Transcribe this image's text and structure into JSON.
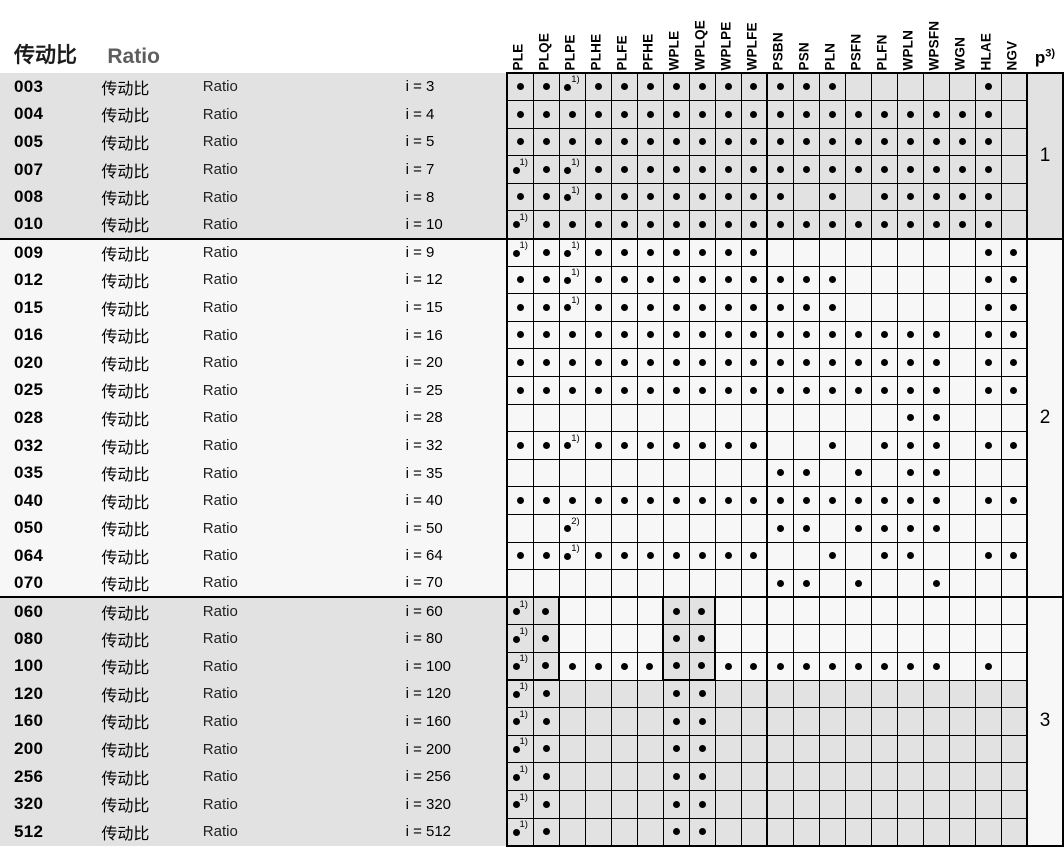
{
  "header": {
    "title_cn": "传动比",
    "title_en": "Ratio",
    "p_label": "p",
    "p_sup": "3)",
    "columns": [
      {
        "key": "PLE",
        "label": "PLE"
      },
      {
        "key": "PLQE",
        "label": "PLQE"
      },
      {
        "key": "PLPE",
        "label": "PLPE"
      },
      {
        "key": "PLHE",
        "label": "PLHE"
      },
      {
        "key": "PLFE",
        "label": "PLFE"
      },
      {
        "key": "PFHE",
        "label": "PFHE"
      },
      {
        "key": "WPLE",
        "label": "WPLE"
      },
      {
        "key": "WPLQE",
        "label": "WPLQE"
      },
      {
        "key": "WPLPE",
        "label": "WPLPE"
      },
      {
        "key": "WPLFE",
        "label": "WPLFE"
      },
      {
        "key": "PSBN",
        "label": "PSBN"
      },
      {
        "key": "PSN",
        "label": "PSN"
      },
      {
        "key": "PLN",
        "label": "PLN"
      },
      {
        "key": "PSFN",
        "label": "PSFN"
      },
      {
        "key": "PLFN",
        "label": "PLFN"
      },
      {
        "key": "WPLN",
        "label": "WPLN"
      },
      {
        "key": "WPSFN",
        "label": "WPSFN"
      },
      {
        "key": "WGN",
        "label": "WGN"
      },
      {
        "key": "HLAE",
        "label": "HLAE"
      },
      {
        "key": "NGV",
        "label": "NGV"
      }
    ]
  },
  "row_labels": {
    "ratio_cn": "传动比",
    "ratio_en": "Ratio"
  },
  "groups": [
    {
      "p": "1",
      "style": "shaded",
      "rows": [
        {
          "code": "003",
          "value": "i = 3",
          "marks": {
            "PLE": "dot",
            "PLQE": "dot",
            "PLPE": "dot1",
            "PLHE": "dot",
            "PLFE": "dot",
            "PFHE": "dot",
            "WPLE": "dot",
            "WPLQE": "dot",
            "WPLPE": "dot",
            "WPLFE": "dot",
            "PSBN": "dot",
            "PSN": "dot",
            "PLN": "dot",
            "HLAE": "dot"
          }
        },
        {
          "code": "004",
          "value": "i = 4",
          "marks": {
            "PLE": "dot",
            "PLQE": "dot",
            "PLPE": "dot",
            "PLHE": "dot",
            "PLFE": "dot",
            "PFHE": "dot",
            "WPLE": "dot",
            "WPLQE": "dot",
            "WPLPE": "dot",
            "WPLFE": "dot",
            "PSBN": "dot",
            "PSN": "dot",
            "PLN": "dot",
            "PSFN": "dot",
            "PLFN": "dot",
            "WPLN": "dot",
            "WPSFN": "dot",
            "WGN": "dot",
            "HLAE": "dot"
          }
        },
        {
          "code": "005",
          "value": "i = 5",
          "marks": {
            "PLE": "dot",
            "PLQE": "dot",
            "PLPE": "dot",
            "PLHE": "dot",
            "PLFE": "dot",
            "PFHE": "dot",
            "WPLE": "dot",
            "WPLQE": "dot",
            "WPLPE": "dot",
            "WPLFE": "dot",
            "PSBN": "dot",
            "PSN": "dot",
            "PLN": "dot",
            "PSFN": "dot",
            "PLFN": "dot",
            "WPLN": "dot",
            "WPSFN": "dot",
            "WGN": "dot",
            "HLAE": "dot"
          }
        },
        {
          "code": "007",
          "value": "i = 7",
          "marks": {
            "PLE": "dot1",
            "PLQE": "dot",
            "PLPE": "dot1",
            "PLHE": "dot",
            "PLFE": "dot",
            "PFHE": "dot",
            "WPLE": "dot",
            "WPLQE": "dot",
            "WPLPE": "dot",
            "WPLFE": "dot",
            "PSBN": "dot",
            "PSN": "dot",
            "PLN": "dot",
            "PSFN": "dot",
            "PLFN": "dot",
            "WPLN": "dot",
            "WPSFN": "dot",
            "WGN": "dot",
            "HLAE": "dot"
          }
        },
        {
          "code": "008",
          "value": "i = 8",
          "marks": {
            "PLE": "dot",
            "PLQE": "dot",
            "PLPE": "dot1",
            "PLHE": "dot",
            "PLFE": "dot",
            "PFHE": "dot",
            "WPLE": "dot",
            "WPLQE": "dot",
            "WPLPE": "dot",
            "WPLFE": "dot",
            "PSBN": "dot",
            "PLN": "dot",
            "PLFN": "dot",
            "WPLN": "dot",
            "WPSFN": "dot",
            "WGN": "dot",
            "HLAE": "dot"
          }
        },
        {
          "code": "010",
          "value": "i = 10",
          "marks": {
            "PLE": "dot1",
            "PLQE": "dot",
            "PLPE": "dot",
            "PLHE": "dot",
            "PLFE": "dot",
            "PFHE": "dot",
            "WPLE": "dot",
            "WPLQE": "dot",
            "WPLPE": "dot",
            "WPLFE": "dot",
            "PSBN": "dot",
            "PSN": "dot",
            "PLN": "dot",
            "PSFN": "dot",
            "PLFN": "dot",
            "WPLN": "dot",
            "WPSFN": "dot",
            "WGN": "dot",
            "HLAE": "dot"
          }
        }
      ]
    },
    {
      "p": "2",
      "style": "plain",
      "rows": [
        {
          "code": "009",
          "value": "i = 9",
          "marks": {
            "PLE": "dot1",
            "PLQE": "dot",
            "PLPE": "dot1",
            "PLHE": "dot",
            "PLFE": "dot",
            "PFHE": "dot",
            "WPLE": "dot",
            "WPLQE": "dot",
            "WPLPE": "dot",
            "WPLFE": "dot",
            "HLAE": "dot",
            "NGV": "dot"
          }
        },
        {
          "code": "012",
          "value": "i = 12",
          "marks": {
            "PLE": "dot",
            "PLQE": "dot",
            "PLPE": "dot1",
            "PLHE": "dot",
            "PLFE": "dot",
            "PFHE": "dot",
            "WPLE": "dot",
            "WPLQE": "dot",
            "WPLPE": "dot",
            "WPLFE": "dot",
            "PSBN": "dot",
            "PSN": "dot",
            "PLN": "dot",
            "HLAE": "dot",
            "NGV": "dot"
          }
        },
        {
          "code": "015",
          "value": "i = 15",
          "marks": {
            "PLE": "dot",
            "PLQE": "dot",
            "PLPE": "dot1",
            "PLHE": "dot",
            "PLFE": "dot",
            "PFHE": "dot",
            "WPLE": "dot",
            "WPLQE": "dot",
            "WPLPE": "dot",
            "WPLFE": "dot",
            "PSBN": "dot",
            "PSN": "dot",
            "PLN": "dot",
            "HLAE": "dot",
            "NGV": "dot"
          }
        },
        {
          "code": "016",
          "value": "i = 16",
          "marks": {
            "PLE": "dot",
            "PLQE": "dot",
            "PLPE": "dot",
            "PLHE": "dot",
            "PLFE": "dot",
            "PFHE": "dot",
            "WPLE": "dot",
            "WPLQE": "dot",
            "WPLPE": "dot",
            "WPLFE": "dot",
            "PSBN": "dot",
            "PSN": "dot",
            "PLN": "dot",
            "PSFN": "dot",
            "PLFN": "dot",
            "WPLN": "dot",
            "WPSFN": "dot",
            "HLAE": "dot",
            "NGV": "dot"
          }
        },
        {
          "code": "020",
          "value": "i = 20",
          "marks": {
            "PLE": "dot",
            "PLQE": "dot",
            "PLPE": "dot",
            "PLHE": "dot",
            "PLFE": "dot",
            "PFHE": "dot",
            "WPLE": "dot",
            "WPLQE": "dot",
            "WPLPE": "dot",
            "WPLFE": "dot",
            "PSBN": "dot",
            "PSN": "dot",
            "PLN": "dot",
            "PSFN": "dot",
            "PLFN": "dot",
            "WPLN": "dot",
            "WPSFN": "dot",
            "HLAE": "dot",
            "NGV": "dot"
          }
        },
        {
          "code": "025",
          "value": "i = 25",
          "marks": {
            "PLE": "dot",
            "PLQE": "dot",
            "PLPE": "dot",
            "PLHE": "dot",
            "PLFE": "dot",
            "PFHE": "dot",
            "WPLE": "dot",
            "WPLQE": "dot",
            "WPLPE": "dot",
            "WPLFE": "dot",
            "PSBN": "dot",
            "PSN": "dot",
            "PLN": "dot",
            "PSFN": "dot",
            "PLFN": "dot",
            "WPLN": "dot",
            "WPSFN": "dot",
            "HLAE": "dot",
            "NGV": "dot"
          }
        },
        {
          "code": "028",
          "value": "i = 28",
          "marks": {
            "WPLN": "dot",
            "WPSFN": "dot"
          }
        },
        {
          "code": "032",
          "value": "i = 32",
          "marks": {
            "PLE": "dot",
            "PLQE": "dot",
            "PLPE": "dot1",
            "PLHE": "dot",
            "PLFE": "dot",
            "PFHE": "dot",
            "WPLE": "dot",
            "WPLQE": "dot",
            "WPLPE": "dot",
            "WPLFE": "dot",
            "PLN": "dot",
            "PLFN": "dot",
            "WPLN": "dot",
            "WPSFN": "dot",
            "HLAE": "dot",
            "NGV": "dot"
          }
        },
        {
          "code": "035",
          "value": "i = 35",
          "marks": {
            "PSBN": "dot",
            "PSN": "dot",
            "PSFN": "dot",
            "WPLN": "dot",
            "WPSFN": "dot"
          }
        },
        {
          "code": "040",
          "value": "i = 40",
          "marks": {
            "PLE": "dot",
            "PLQE": "dot",
            "PLPE": "dot",
            "PLHE": "dot",
            "PLFE": "dot",
            "PFHE": "dot",
            "WPLE": "dot",
            "WPLQE": "dot",
            "WPLPE": "dot",
            "WPLFE": "dot",
            "PSBN": "dot",
            "PSN": "dot",
            "PLN": "dot",
            "PSFN": "dot",
            "PLFN": "dot",
            "WPLN": "dot",
            "WPSFN": "dot",
            "HLAE": "dot",
            "NGV": "dot"
          }
        },
        {
          "code": "050",
          "value": "i = 50",
          "marks": {
            "PLPE": "dot2",
            "PSBN": "dot",
            "PSN": "dot",
            "PSFN": "dot",
            "PLFN": "dot",
            "WPLN": "dot",
            "WPSFN": "dot"
          }
        },
        {
          "code": "064",
          "value": "i = 64",
          "marks": {
            "PLE": "dot",
            "PLQE": "dot",
            "PLPE": "dot1",
            "PLHE": "dot",
            "PLFE": "dot",
            "PFHE": "dot",
            "WPLE": "dot",
            "WPLQE": "dot",
            "WPLPE": "dot",
            "WPLFE": "dot",
            "PLN": "dot",
            "PLFN": "dot",
            "WPLN": "dot",
            "HLAE": "dot",
            "NGV": "dot"
          }
        },
        {
          "code": "070",
          "value": "i = 70",
          "marks": {
            "PSBN": "dot",
            "PSN": "dot",
            "PSFN": "dot",
            "WPSFN": "dot"
          }
        }
      ]
    },
    {
      "p": "3",
      "style": "shaded",
      "rows": [
        {
          "code": "060",
          "value": "i = 60",
          "style": "mixed",
          "marks": {
            "PLE": "dot1",
            "PLQE": "dot",
            "WPLE": "dot",
            "WPLQE": "dot"
          }
        },
        {
          "code": "080",
          "value": "i = 80",
          "style": "mixed",
          "marks": {
            "PLE": "dot1",
            "PLQE": "dot",
            "WPLE": "dot",
            "WPLQE": "dot"
          }
        },
        {
          "code": "100",
          "value": "i = 100",
          "style": "mixed",
          "marks": {
            "PLE": "dot1",
            "PLQE": "dot",
            "PLPE": "dot",
            "PLHE": "dot",
            "PLFE": "dot",
            "PFHE": "dot",
            "WPLE": "dot",
            "WPLQE": "dot",
            "WPLPE": "dot",
            "WPLFE": "dot",
            "PSBN": "dot",
            "PSN": "dot",
            "PLN": "dot",
            "PSFN": "dot",
            "PLFN": "dot",
            "WPLN": "dot",
            "WPSFN": "dot",
            "HLAE": "dot"
          }
        },
        {
          "code": "120",
          "value": "i = 120",
          "style": "shaded",
          "marks": {
            "PLE": "dot1",
            "PLQE": "dot",
            "WPLE": "dot",
            "WPLQE": "dot"
          }
        },
        {
          "code": "160",
          "value": "i = 160",
          "style": "shaded",
          "marks": {
            "PLE": "dot1",
            "PLQE": "dot",
            "WPLE": "dot",
            "WPLQE": "dot"
          }
        },
        {
          "code": "200",
          "value": "i = 200",
          "style": "shaded",
          "marks": {
            "PLE": "dot1",
            "PLQE": "dot",
            "WPLE": "dot",
            "WPLQE": "dot"
          }
        },
        {
          "code": "256",
          "value": "i = 256",
          "style": "shaded",
          "marks": {
            "PLE": "dot1",
            "PLQE": "dot",
            "WPLE": "dot",
            "WPLQE": "dot"
          }
        },
        {
          "code": "320",
          "value": "i = 320",
          "style": "shaded",
          "marks": {
            "PLE": "dot1",
            "PLQE": "dot",
            "WPLE": "dot",
            "WPLQE": "dot"
          }
        },
        {
          "code": "512",
          "value": "i = 512",
          "style": "shaded",
          "marks": {
            "PLE": "dot1",
            "PLQE": "dot",
            "WPLE": "dot",
            "WPLQE": "dot"
          }
        }
      ]
    }
  ],
  "mark_superscripts": {
    "dot1": "1)",
    "dot2": "2)"
  },
  "thick_divider_after": "WPLFE"
}
